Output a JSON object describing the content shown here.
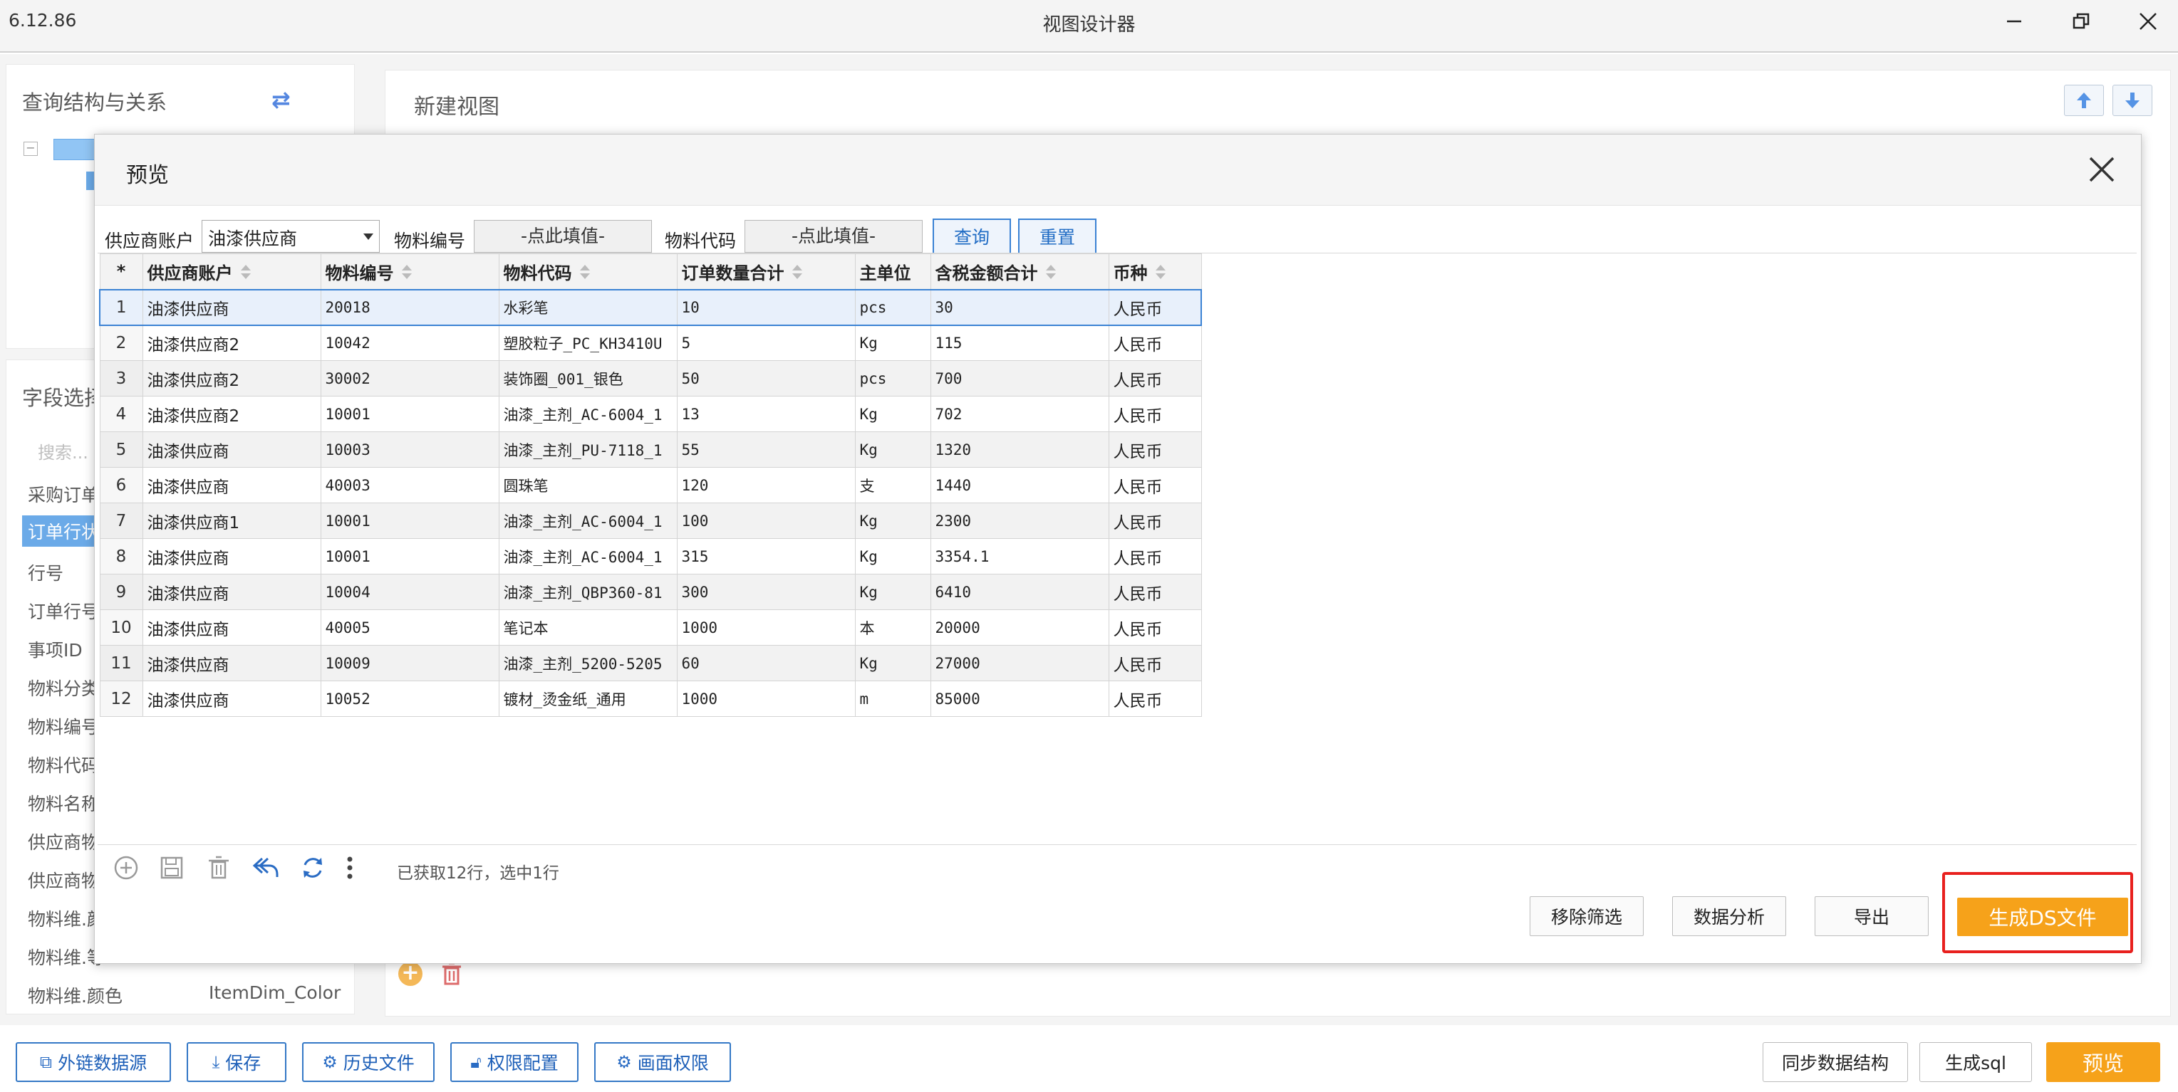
{
  "window": {
    "version": "6.12.86",
    "title": "视图设计器"
  },
  "left_panel": {
    "title": "查询结构与关系",
    "tree_box": "−"
  },
  "field_panel": {
    "title": "字段选择",
    "search_placeholder": "搜索...",
    "items": [
      "采购订单",
      "订单行状",
      "行号",
      "订单行号",
      "事项ID",
      "物料分类",
      "物料编号",
      "物料代码",
      "物料名称",
      "供应商物",
      "供应商物",
      "物料维.颜",
      "物料维.等",
      "物料维.颜色"
    ],
    "last_item_value": "ItemDim_Color"
  },
  "right_panel": {
    "title": "新建视图"
  },
  "modal": {
    "title": "预览",
    "filters": {
      "supplier_label": "供应商账户",
      "supplier_value": "油漆供应商",
      "material_no_label": "物料编号",
      "material_no_placeholder": "-点此填值-",
      "material_code_label": "物料代码",
      "material_code_placeholder": "-点此填值-",
      "query_button": "查询",
      "reset_button": "重置"
    },
    "grid": {
      "columns": [
        "*",
        "供应商账户",
        "物料编号",
        "物料代码",
        "订单数量合计",
        "主单位",
        "含税金额合计",
        "币种"
      ],
      "rows": [
        [
          "1",
          "油漆供应商",
          "20018",
          "水彩笔",
          "10",
          "pcs",
          "30",
          "人民币"
        ],
        [
          "2",
          "油漆供应商2",
          "10042",
          "塑胶粒子_PC_KH3410U",
          "5",
          "Kg",
          "115",
          "人民币"
        ],
        [
          "3",
          "油漆供应商2",
          "30002",
          "装饰圈_001_银色",
          "50",
          "pcs",
          "700",
          "人民币"
        ],
        [
          "4",
          "油漆供应商2",
          "10001",
          "油漆_主剂_AC-6004_1",
          "13",
          "Kg",
          "702",
          "人民币"
        ],
        [
          "5",
          "油漆供应商",
          "10003",
          "油漆_主剂_PU-7118_1",
          "55",
          "Kg",
          "1320",
          "人民币"
        ],
        [
          "6",
          "油漆供应商",
          "40003",
          "圆珠笔",
          "120",
          "支",
          "1440",
          "人民币"
        ],
        [
          "7",
          "油漆供应商1",
          "10001",
          "油漆_主剂_AC-6004_1",
          "100",
          "Kg",
          "2300",
          "人民币"
        ],
        [
          "8",
          "油漆供应商",
          "10001",
          "油漆_主剂_AC-6004_1",
          "315",
          "Kg",
          "3354.1",
          "人民币"
        ],
        [
          "9",
          "油漆供应商",
          "10004",
          "油漆_主剂_QBP360-81",
          "300",
          "Kg",
          "6410",
          "人民币"
        ],
        [
          "10",
          "油漆供应商",
          "40005",
          "笔记本",
          "1000",
          "本",
          "20000",
          "人民币"
        ],
        [
          "11",
          "油漆供应商",
          "10009",
          "油漆_主剂_5200-5205",
          "60",
          "Kg",
          "27000",
          "人民币"
        ],
        [
          "12",
          "油漆供应商",
          "10052",
          "镀材_烫金纸_通用",
          "1000",
          "m",
          "85000",
          "人民币"
        ]
      ],
      "selected_row": 0
    },
    "status": "已获取12行，选中1行",
    "footer": {
      "remove_filter": "移除筛选",
      "data_analysis": "数据分析",
      "export": "导出",
      "generate_ds": "生成DS文件"
    }
  },
  "bottom_bar": {
    "external_source": "外链数据源",
    "save": "保存",
    "history": "历史文件",
    "permission_config": "权限配置",
    "screen_permission": "画面权限",
    "sync_structure": "同步数据结构",
    "generate_sql": "生成sql",
    "preview": "预览"
  },
  "colors": {
    "accent_blue": "#3b82d4",
    "primary_orange": "#f6a21a",
    "highlight_red": "#e8201e"
  }
}
